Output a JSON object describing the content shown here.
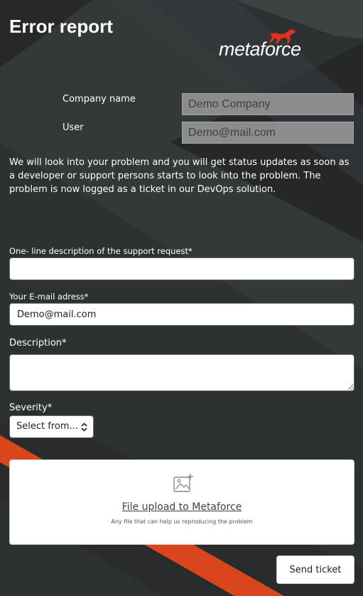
{
  "page_title": "Error report",
  "brand": {
    "logo_text": "metaforce",
    "accent_color": "#e0311f",
    "stripe_color": "#d9461d"
  },
  "info": {
    "company_label": "Company name",
    "company_value": "Demo Company",
    "user_label": "User",
    "user_value": "Demo@mail.com"
  },
  "intro_text": "We will look into your problem and you will get status updates as soon as a developer or support persons starts to look into the problem. The problem is now logged as a ticket in our DevOps solution.",
  "form": {
    "oneline_label": "One- line description of the support request*",
    "oneline_value": "",
    "email_label": "Your E-mail adress*",
    "email_value": "Demo@mail.com",
    "description_label": "Description*",
    "description_value": "",
    "severity_label": "Severity*",
    "severity_selected": "Select from..."
  },
  "upload": {
    "icon": "add-image-icon",
    "title": "File upload to Metaforce",
    "subtitle": "Any file that can help us reproducing the problem"
  },
  "send_button": "Send ticket"
}
